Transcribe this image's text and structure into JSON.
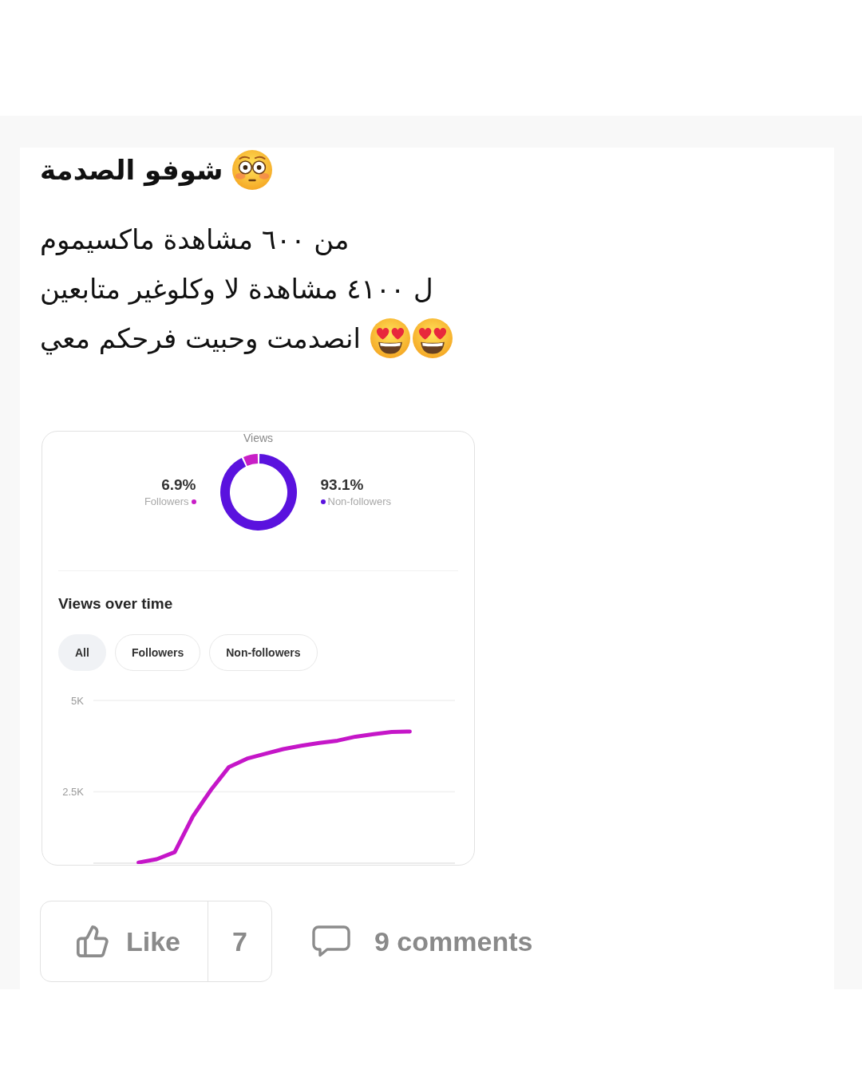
{
  "post": {
    "title": {
      "text": "شوفو الصدمة",
      "emojis": [
        {
          "kind": "flushed-face"
        }
      ]
    },
    "lines": [
      {
        "text": "من ٦٠٠ مشاهدة ماكسيموم"
      },
      {
        "text": "ل ٤١٠٠ مشاهدة لا وكلوغير متابعين"
      },
      {
        "text": "انصدمت وحبيت فرحكم معي",
        "emojis": [
          {
            "kind": "heart-eyes-face"
          },
          {
            "kind": "heart-eyes-face"
          }
        ]
      }
    ]
  },
  "insights_card": {
    "donut": {
      "chart_data": {
        "type": "donut",
        "title": "Views",
        "categories": [
          "Followers",
          "Non-followers"
        ],
        "values": [
          6.9,
          93.1
        ],
        "value_labels": [
          "6.9%",
          "93.1%"
        ],
        "colors": [
          "#c81ec6",
          "#5a12de"
        ]
      }
    },
    "section_title": "Views over time",
    "filters": [
      {
        "label": "All",
        "selected": true
      },
      {
        "label": "Followers",
        "selected": false
      },
      {
        "label": "Non-followers",
        "selected": false
      }
    ],
    "line_chart": {
      "chart_data": {
        "type": "line",
        "categories": [
          null,
          null,
          null,
          null,
          null,
          null,
          null,
          null,
          null,
          null,
          null,
          null,
          null,
          null,
          null,
          null,
          null,
          null,
          null,
          null
        ],
        "ylim": [
          550,
          5000
        ],
        "yticks": [
          {
            "value": 2500,
            "label": "2.5K"
          },
          {
            "value": 5000,
            "label": "5K"
          }
        ],
        "series": [
          {
            "color": "#c516c8",
            "values": [
              null,
              null,
              570,
              660,
              850,
              1830,
              2550,
              3180,
              3410,
              3540,
              3670,
              3760,
              3840,
              3900,
              4010,
              4080,
              4140,
              4150,
              null,
              null
            ]
          }
        ]
      }
    }
  },
  "actions": {
    "like_label": "Like",
    "like_count": "7",
    "comments_label": "9 comments"
  }
}
